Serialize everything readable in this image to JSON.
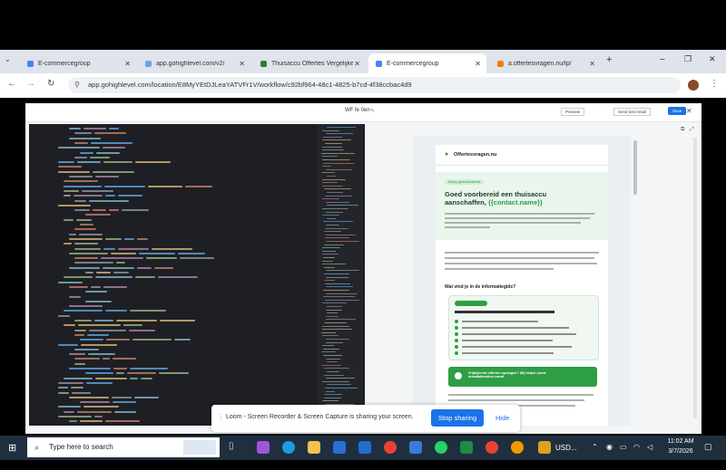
{
  "browser": {
    "tabs": [
      {
        "label": "E-commercegroup",
        "color": "#4285f4"
      },
      {
        "label": "app.gohighlevel.com/v2/",
        "color": "#6aa0f0"
      },
      {
        "label": "Thuisaccu Offertes Vergelijken",
        "color": "#2e7d32"
      },
      {
        "label": "E-commercegroup",
        "color": "#4285f4",
        "active": true
      },
      {
        "label": "a.offertesvragen.nu/lp/",
        "color": "#f57c00"
      }
    ],
    "new_tab": "+",
    "url": "app.gohighlevel.com/location/E8MyYEtDJLeaYATVFr1V/workflow/c92bf964-48c1-4825-b7cd-4f38ccbac4d9"
  },
  "app": {
    "title": "WF fe 0en",
    "actions": [
      "Preview",
      "Send test email",
      "Save"
    ]
  },
  "email": {
    "brand": "Offertesvragen.nu",
    "badge": "Inloop gesubsidieerd",
    "headline_1": "Goed voorbereid een thuisaccu",
    "headline_2": "aanschaffen,",
    "headline_var": "{{contact.name}}",
    "section_title": "Wat vind je in de informatiegids?",
    "green_card_title": "Vrijblijvend offertes opvragen? Wij helpen jouw",
    "green_card_title_2": "installatiezaken-vanaf"
  },
  "loom": {
    "message": "Loom - Screen Recorder & Screen Capture is sharing your screen.",
    "stop": "Stop sharing",
    "hide": "Hide"
  },
  "taskbar": {
    "search_placeholder": "Type here to search",
    "currency": "USD...",
    "time": "11:02 AM",
    "date": "3/7/2026"
  },
  "colors": {
    "accent": "#1a73e8",
    "email_green": "#2e9e44",
    "editor_bg": "#1e1f24"
  }
}
